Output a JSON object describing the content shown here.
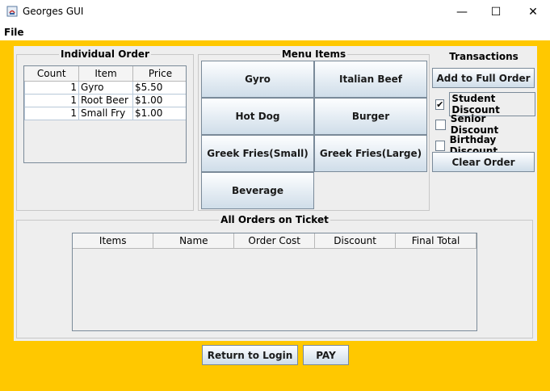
{
  "window": {
    "title": "Georges GUI",
    "minimize": "—",
    "maximize": "☐",
    "close": "✕"
  },
  "menu": {
    "file": "File"
  },
  "individual_order": {
    "title": "Individual Order",
    "columns": [
      "Count",
      "Item",
      "Price"
    ],
    "rows": [
      {
        "count": "1",
        "item": "Gyro",
        "price": "$5.50"
      },
      {
        "count": "1",
        "item": "Root Beer",
        "price": "$1.00"
      },
      {
        "count": "1",
        "item": "Small Fry",
        "price": "$1.00"
      }
    ]
  },
  "menu_items": {
    "title": "Menu Items",
    "buttons": [
      "Gyro",
      "Italian Beef",
      "Hot Dog",
      "Burger",
      "Greek Fries(Small)",
      "Greek Fries(Large)",
      "Beverage"
    ]
  },
  "transactions": {
    "title": "Transactions",
    "add_label": "Add to Full Order",
    "student": {
      "label": "Student Discount",
      "checked": "✔"
    },
    "senior": {
      "label": "Senior Discount",
      "checked": ""
    },
    "birthday": {
      "label": "Birthday Discount",
      "checked": ""
    },
    "clear_label": "Clear Order"
  },
  "all_orders": {
    "title": "All Orders on Ticket",
    "columns": [
      "Items",
      "Name",
      "Order Cost",
      "Discount",
      "Final Total"
    ]
  },
  "footer": {
    "return_label": "Return to Login",
    "pay_label": "PAY"
  },
  "colors": {
    "background": "#ffc800",
    "panel": "#eeeeee"
  }
}
